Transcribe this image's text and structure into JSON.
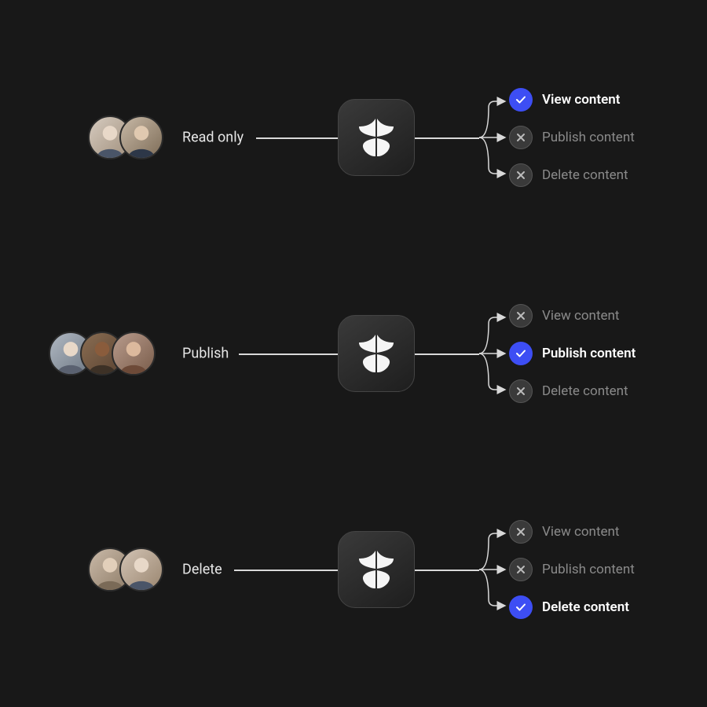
{
  "roles": [
    {
      "name": "Read only",
      "avatar_count": 2,
      "permissions": [
        {
          "label": "View content",
          "allowed": true
        },
        {
          "label": "Publish content",
          "allowed": false
        },
        {
          "label": "Delete content",
          "allowed": false
        }
      ]
    },
    {
      "name": "Publish",
      "avatar_count": 3,
      "permissions": [
        {
          "label": "View content",
          "allowed": false
        },
        {
          "label": "Publish content",
          "allowed": true
        },
        {
          "label": "Delete content",
          "allowed": false
        }
      ]
    },
    {
      "name": "Delete",
      "avatar_count": 2,
      "permissions": [
        {
          "label": "View content",
          "allowed": false
        },
        {
          "label": "Publish content",
          "allowed": false
        },
        {
          "label": "Delete content",
          "allowed": true
        }
      ]
    }
  ],
  "icons": {
    "shield": "shield-icon",
    "check": "check-icon",
    "cross": "cross-icon",
    "arrow": "arrow-icon"
  },
  "colors": {
    "accent": "#3d4ef4",
    "bg": "#181818",
    "muted": "#8a8a8a"
  }
}
